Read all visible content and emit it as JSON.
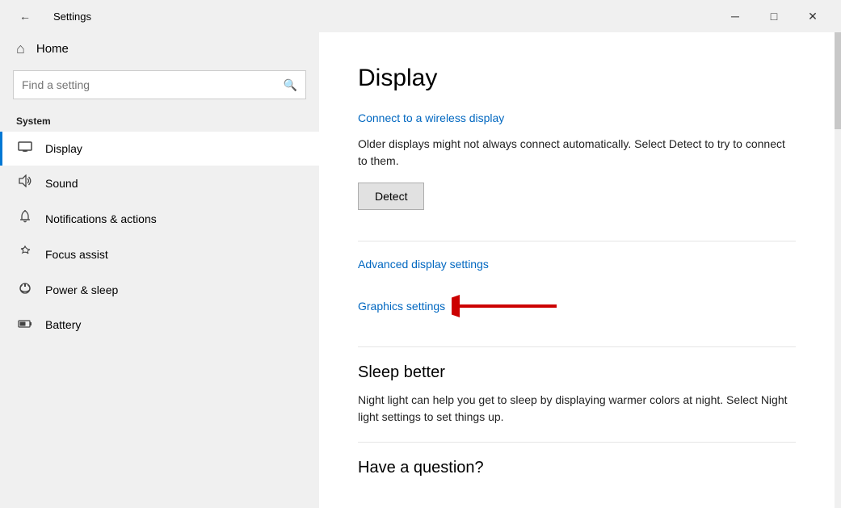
{
  "titlebar": {
    "title": "Settings",
    "back_icon": "←",
    "minimize": "─",
    "maximize": "□",
    "close": "✕"
  },
  "sidebar": {
    "home_label": "Home",
    "search_placeholder": "Find a setting",
    "section_label": "System",
    "items": [
      {
        "id": "display",
        "label": "Display",
        "icon": "🖥",
        "active": true
      },
      {
        "id": "sound",
        "label": "Sound",
        "icon": "🔊"
      },
      {
        "id": "notifications",
        "label": "Notifications & actions",
        "icon": "🔔"
      },
      {
        "id": "focus",
        "label": "Focus assist",
        "icon": "🌙"
      },
      {
        "id": "power",
        "label": "Power & sleep",
        "icon": "⏻"
      },
      {
        "id": "battery",
        "label": "Battery",
        "icon": "🔋"
      }
    ]
  },
  "content": {
    "title": "Display",
    "wireless_link": "Connect to a wireless display",
    "wireless_desc": "Older displays might not always connect automatically. Select Detect to try to connect to them.",
    "detect_btn": "Detect",
    "advanced_link": "Advanced display settings",
    "graphics_link": "Graphics settings",
    "sleep_title": "Sleep better",
    "sleep_desc": "Night light can help you get to sleep by displaying warmer colors at night. Select Night light settings to set things up.",
    "have_question": "Have a question?"
  }
}
